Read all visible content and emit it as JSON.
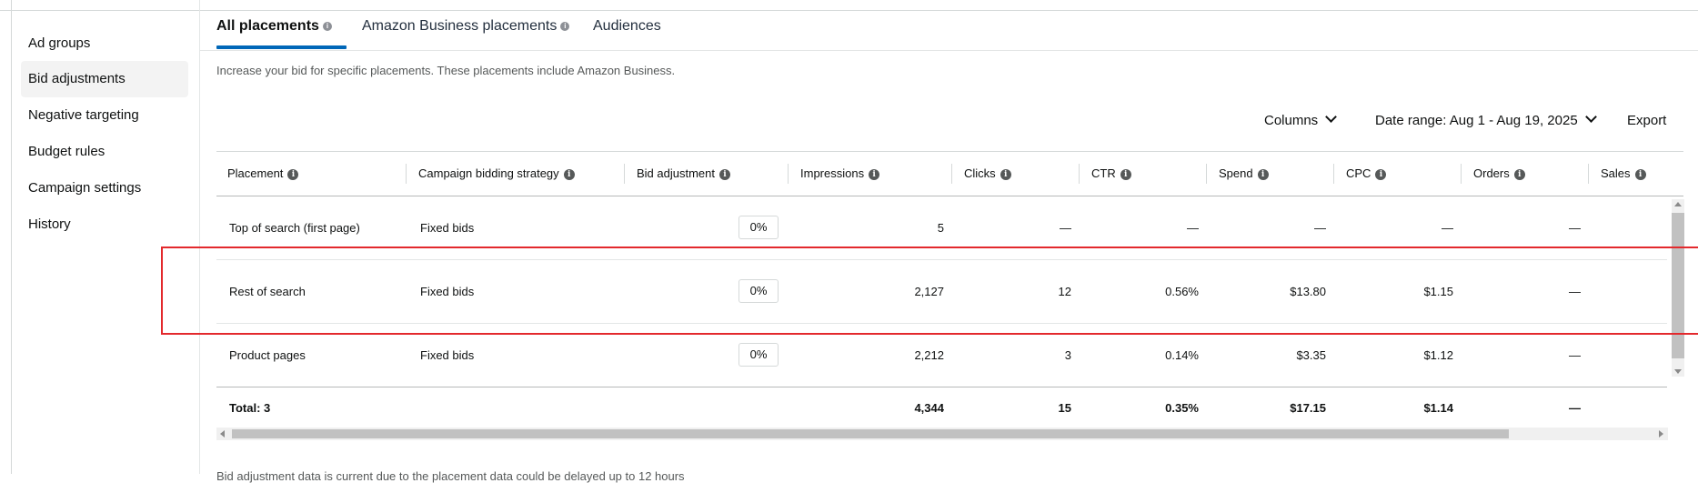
{
  "sidebar": {
    "items": [
      {
        "label": "Ad groups"
      },
      {
        "label": "Bid adjustments"
      },
      {
        "label": "Negative targeting"
      },
      {
        "label": "Budget rules"
      },
      {
        "label": "Campaign settings"
      },
      {
        "label": "History"
      }
    ],
    "active": "Bid adjustments"
  },
  "tabs": [
    {
      "label": "All placements",
      "info": "i"
    },
    {
      "label": "Amazon Business placements",
      "info": "i"
    },
    {
      "label": "Audiences"
    }
  ],
  "description": "Increase your bid for specific placements. These placements include Amazon Business.",
  "toolbar": {
    "columns_label": "Columns",
    "date_range_label": "Date range: Aug 1 - Aug 19, 2025",
    "export_label": "Export"
  },
  "table": {
    "info_glyph": "i",
    "headers": [
      "Placement",
      "Campaign bidding strategy",
      "Bid adjustment",
      "Impressions",
      "Clicks",
      "CTR",
      "Spend",
      "CPC",
      "Orders",
      "Sales"
    ],
    "rows": [
      {
        "placement": "Top of search (first page)",
        "strategy": "Fixed bids",
        "bid_adjustment": "0%",
        "impressions": "5",
        "clicks": "—",
        "ctr": "—",
        "spend": "—",
        "cpc": "—",
        "orders": "—"
      },
      {
        "placement": "Rest of search",
        "strategy": "Fixed bids",
        "bid_adjustment": "0%",
        "impressions": "2,127",
        "clicks": "12",
        "ctr": "0.56%",
        "spend": "$13.80",
        "cpc": "$1.15",
        "orders": "—"
      },
      {
        "placement": "Product pages",
        "strategy": "Fixed bids",
        "bid_adjustment": "0%",
        "impressions": "2,212",
        "clicks": "3",
        "ctr": "0.14%",
        "spend": "$3.35",
        "cpc": "$1.12",
        "orders": "—"
      }
    ],
    "total": {
      "label": "Total: 3",
      "impressions": "4,344",
      "clicks": "15",
      "ctr": "0.35%",
      "spend": "$17.15",
      "cpc": "$1.14",
      "orders": "—"
    }
  },
  "colors": {
    "accent": "#0067b8",
    "highlight": "#e3292d"
  },
  "footer_note": "Bid adjustment data is current due to the placement data could be delayed up to 12 hours"
}
